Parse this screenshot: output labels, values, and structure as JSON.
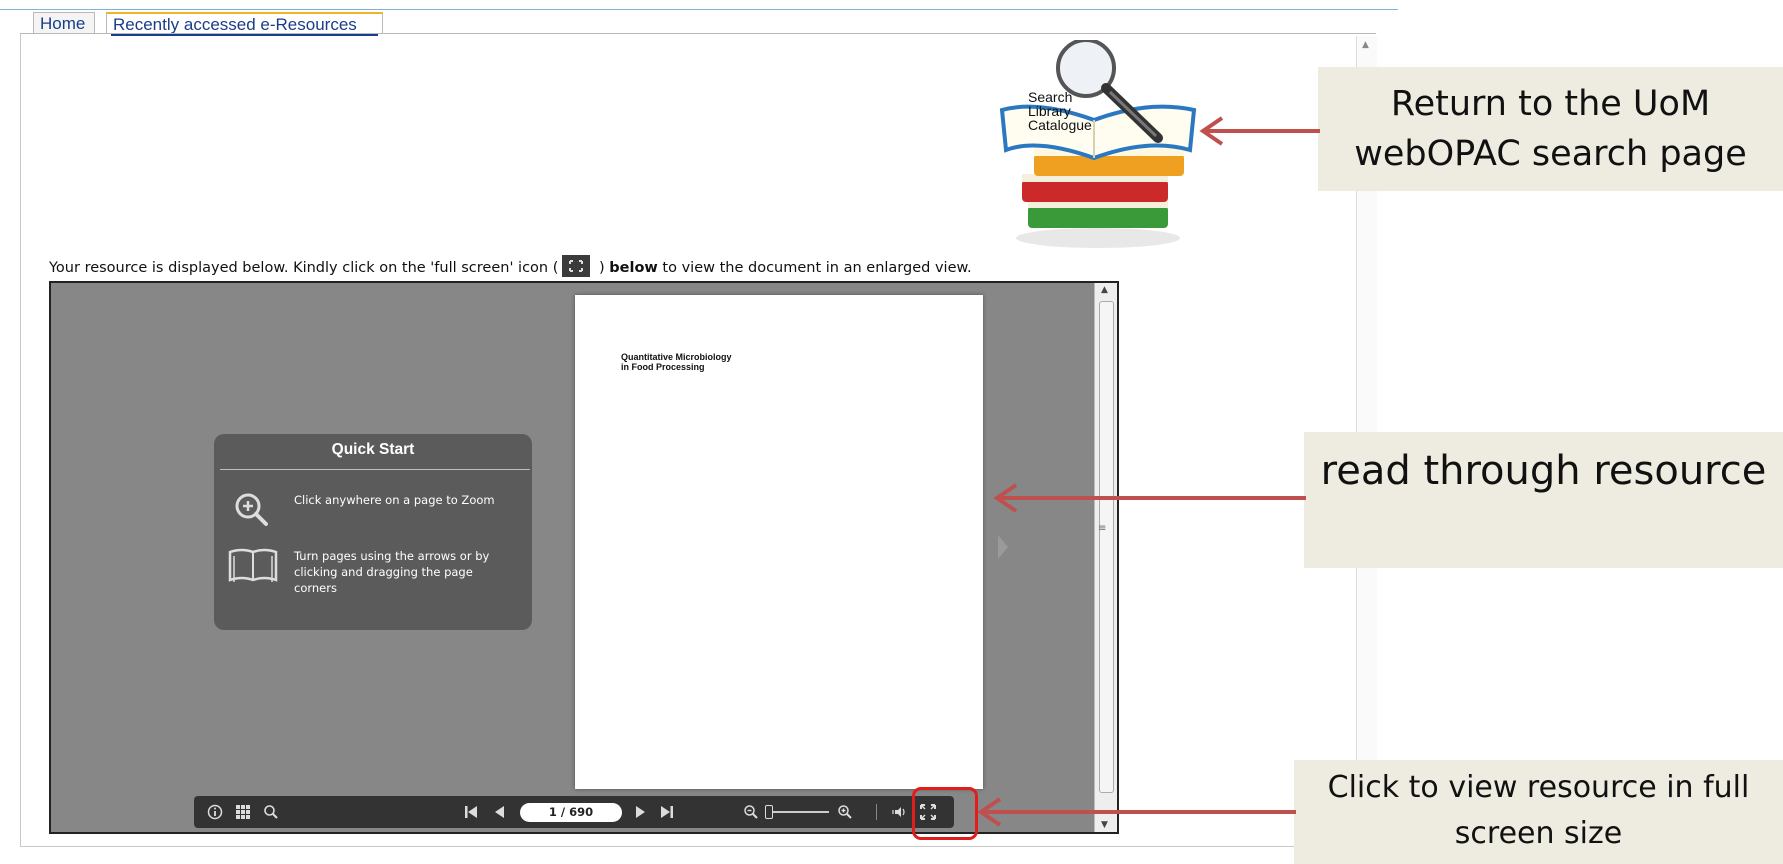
{
  "tabs": [
    {
      "label": "Home",
      "active": false
    },
    {
      "label": "Recently accessed e-Resources",
      "active": true
    }
  ],
  "catalogue_link": {
    "lines": [
      "Search",
      "Library",
      "Catalogue"
    ]
  },
  "intro": {
    "part1": "Your resource is displayed below. Kindly click on the 'full screen' icon (",
    "part2": " ) ",
    "bold": "below",
    "part3": " to view the document in an enlarged view."
  },
  "viewer": {
    "page_title": "Quantitative Microbiology\nin Food Processing",
    "quick_start": {
      "title": "Quick Start",
      "tip_zoom": "Click anywhere on a page to Zoom",
      "tip_turn": "Turn pages using the arrows or by clicking and dragging the page corners"
    },
    "toolbar": {
      "page_indicator": "1 / 690",
      "icons": [
        "info-icon",
        "grid-icon",
        "search-icon",
        "first-page-icon",
        "previous-page-icon",
        "next-page-icon",
        "last-page-icon",
        "zoom-out-icon",
        "zoom-in-icon",
        "sound-icon",
        "fullscreen-icon"
      ]
    }
  },
  "callouts": {
    "webopac": "Return to the UoM webOPAC search page",
    "read": "read through resource",
    "fullscreen": "Click to view resource in full screen size"
  },
  "colors": {
    "arrow": "#c0504d",
    "callout_bg": "#eeece1",
    "highlight": "#e11d1d",
    "tab_accent": "#f0b429",
    "link": "#1a3d8a"
  }
}
